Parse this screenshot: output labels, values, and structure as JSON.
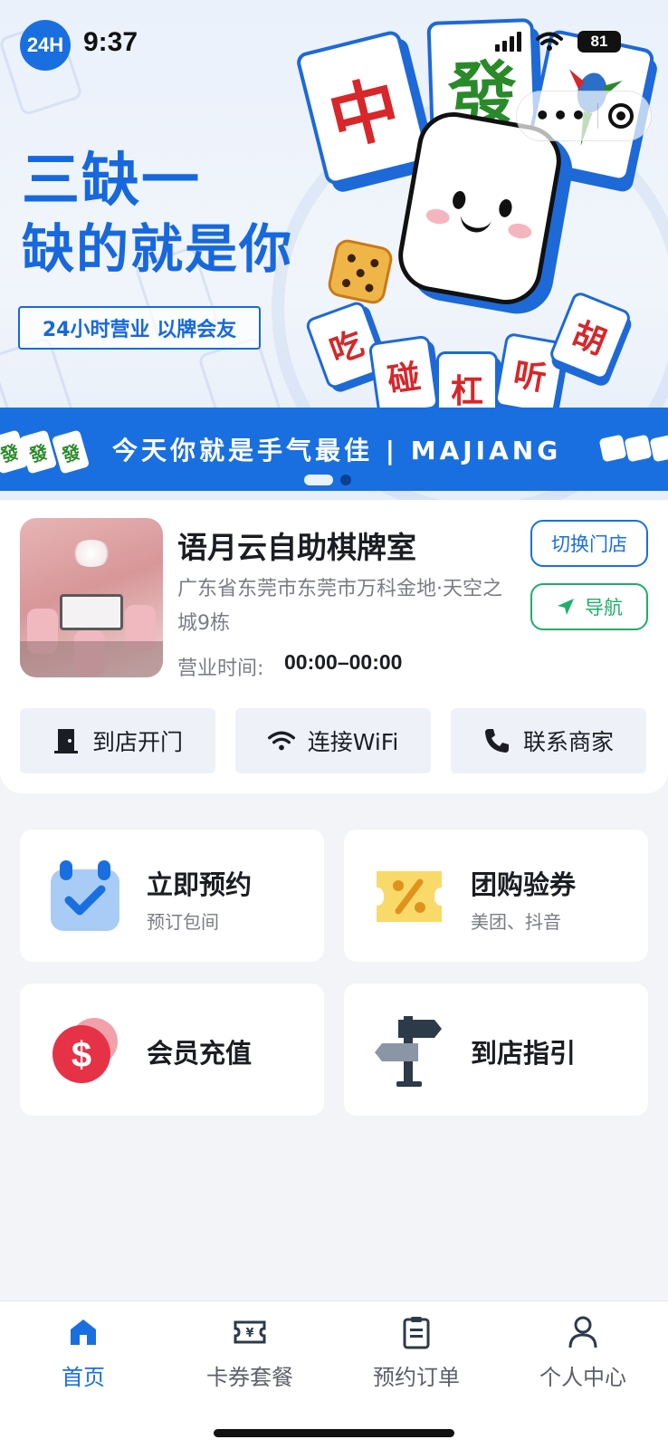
{
  "status": {
    "time": "9:37",
    "battery": "81",
    "logo": "24H"
  },
  "banner": {
    "headline_1": "三缺一",
    "headline_2": "缺的就是你",
    "tagline": "24小时营业 以牌会友",
    "ticker": "今天你就是手气最佳 | MAJIANG",
    "tiles": [
      "中",
      "發"
    ],
    "small_tiles": [
      "吃",
      "碰",
      "杠",
      "听",
      "胡"
    ],
    "active_slide": 1,
    "slide_count": 2
  },
  "store": {
    "name": "语月云自助棋牌室",
    "address": "广东省东莞市东莞市万科金地·天空之城9栋",
    "hours_label": "营业时间:",
    "hours_value": "00:00–00:00",
    "switch_label": "切换门店",
    "nav_label": "导航"
  },
  "actions": [
    {
      "label": "到店开门",
      "icon": "door-icon"
    },
    {
      "label": "连接WiFi",
      "icon": "wifi-icon"
    },
    {
      "label": "联系商家",
      "icon": "phone-icon"
    }
  ],
  "features": [
    {
      "title": "立即预约",
      "subtitle": "预订包间",
      "icon": "calendar-check-icon"
    },
    {
      "title": "团购验券",
      "subtitle": "美团、抖音",
      "icon": "coupon-icon"
    },
    {
      "title": "会员充值",
      "subtitle": "",
      "icon": "coin-icon"
    },
    {
      "title": "到店指引",
      "subtitle": "",
      "icon": "signpost-icon"
    }
  ],
  "tabs": [
    {
      "label": "首页",
      "icon": "home-icon",
      "active": true
    },
    {
      "label": "卡券套餐",
      "icon": "ticket-icon",
      "active": false
    },
    {
      "label": "预约订单",
      "icon": "clipboard-icon",
      "active": false
    },
    {
      "label": "个人中心",
      "icon": "user-icon",
      "active": false
    }
  ],
  "colors": {
    "primary": "#1a6fe0",
    "nav_green": "#1fae6a",
    "page_bg": "#f3f4f7"
  }
}
